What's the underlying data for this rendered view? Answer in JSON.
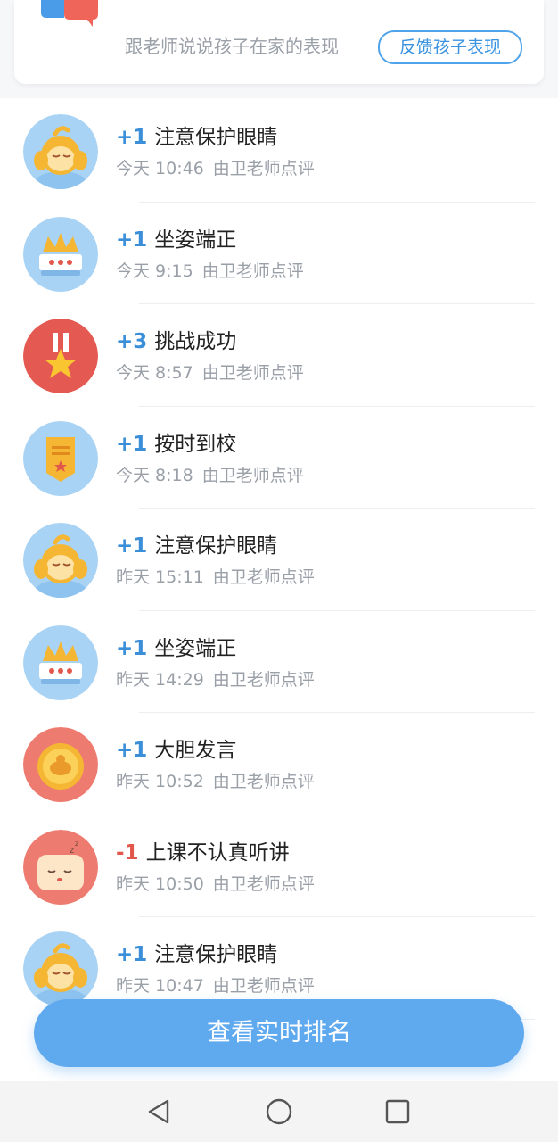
{
  "feedback_card": {
    "prompt_text": "跟老师说说孩子在家的表现",
    "button_label": "反馈孩子表现"
  },
  "records": [
    {
      "points": "+1",
      "points_type": "positive",
      "title": "注意保护眼睛",
      "time": "今天 10:46",
      "reviewer": "由卫老师点评",
      "icon": "monkey-covering-eyes-icon"
    },
    {
      "points": "+1",
      "points_type": "positive",
      "title": "坐姿端正",
      "time": "今天 9:15",
      "reviewer": "由卫老师点评",
      "icon": "crown-desk-icon"
    },
    {
      "points": "+3",
      "points_type": "positive",
      "title": "挑战成功",
      "time": "今天 8:57",
      "reviewer": "由卫老师点评",
      "icon": "star-medal-icon"
    },
    {
      "points": "+1",
      "points_type": "positive",
      "title": "按时到校",
      "time": "今天 8:18",
      "reviewer": "由卫老师点评",
      "icon": "badge-banner-icon"
    },
    {
      "points": "+1",
      "points_type": "positive",
      "title": "注意保护眼睛",
      "time": "昨天 15:11",
      "reviewer": "由卫老师点评",
      "icon": "monkey-covering-eyes-icon"
    },
    {
      "points": "+1",
      "points_type": "positive",
      "title": "坐姿端正",
      "time": "昨天 14:29",
      "reviewer": "由卫老师点评",
      "icon": "crown-desk-icon"
    },
    {
      "points": "+1",
      "points_type": "positive",
      "title": "大胆发言",
      "time": "昨天 10:52",
      "reviewer": "由卫老师点评",
      "icon": "gold-coin-icon"
    },
    {
      "points": "-1",
      "points_type": "negative",
      "title": "上课不认真听讲",
      "time": "昨天 10:50",
      "reviewer": "由卫老师点评",
      "icon": "sleepy-pillow-icon"
    },
    {
      "points": "+1",
      "points_type": "positive",
      "title": "注意保护眼睛",
      "time": "昨天 10:47",
      "reviewer": "由卫老师点评",
      "icon": "monkey-covering-eyes-icon"
    }
  ],
  "rank_button_label": "查看实时排名",
  "nav": {
    "back": "back-icon",
    "home": "home-icon",
    "recents": "recents-icon"
  },
  "colors": {
    "positive_points": "#3b8fd9",
    "negative_points": "#e2574c",
    "primary_button": "#5fa9ef",
    "avatar_blue_bg": "#a8d3f5",
    "avatar_red_bg": "#ee7b70"
  }
}
